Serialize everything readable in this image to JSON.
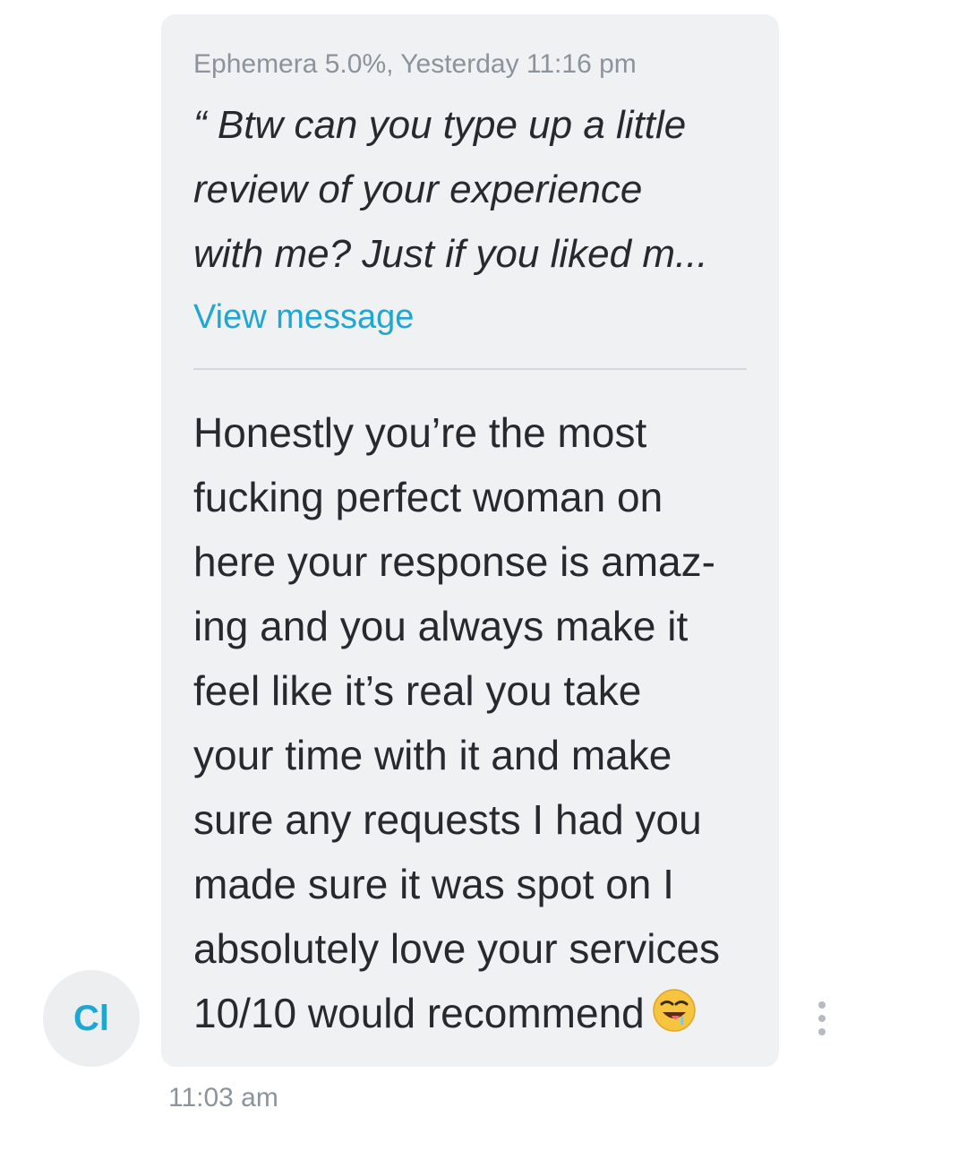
{
  "quoted_message": {
    "meta": "Ephemera 5.0%, Yesterday 11:16 pm",
    "lines": [
      "“ Btw can you type up a little",
      "review of your experience",
      "with me? Just if you liked m..."
    ],
    "view_link": "View message"
  },
  "message": {
    "lines": [
      "Honestly you’re the most",
      "fucking perfect woman on",
      "here your response is amaz-",
      "ing and you always make it",
      "feel like it’s real you take",
      "your time with it and make",
      "sure any requests I had you",
      "made sure it was spot on I",
      "absolutely love your services",
      "10/10 would recommend"
    ],
    "emoji": "drooling-face-icon",
    "timestamp": "11:03 am"
  },
  "sender": {
    "initials": "Cl"
  },
  "colors": {
    "bubble": "#f0f1f3",
    "accent": "#1fa7d2",
    "meta_text": "#8b939c",
    "body_text": "#262a2e"
  }
}
